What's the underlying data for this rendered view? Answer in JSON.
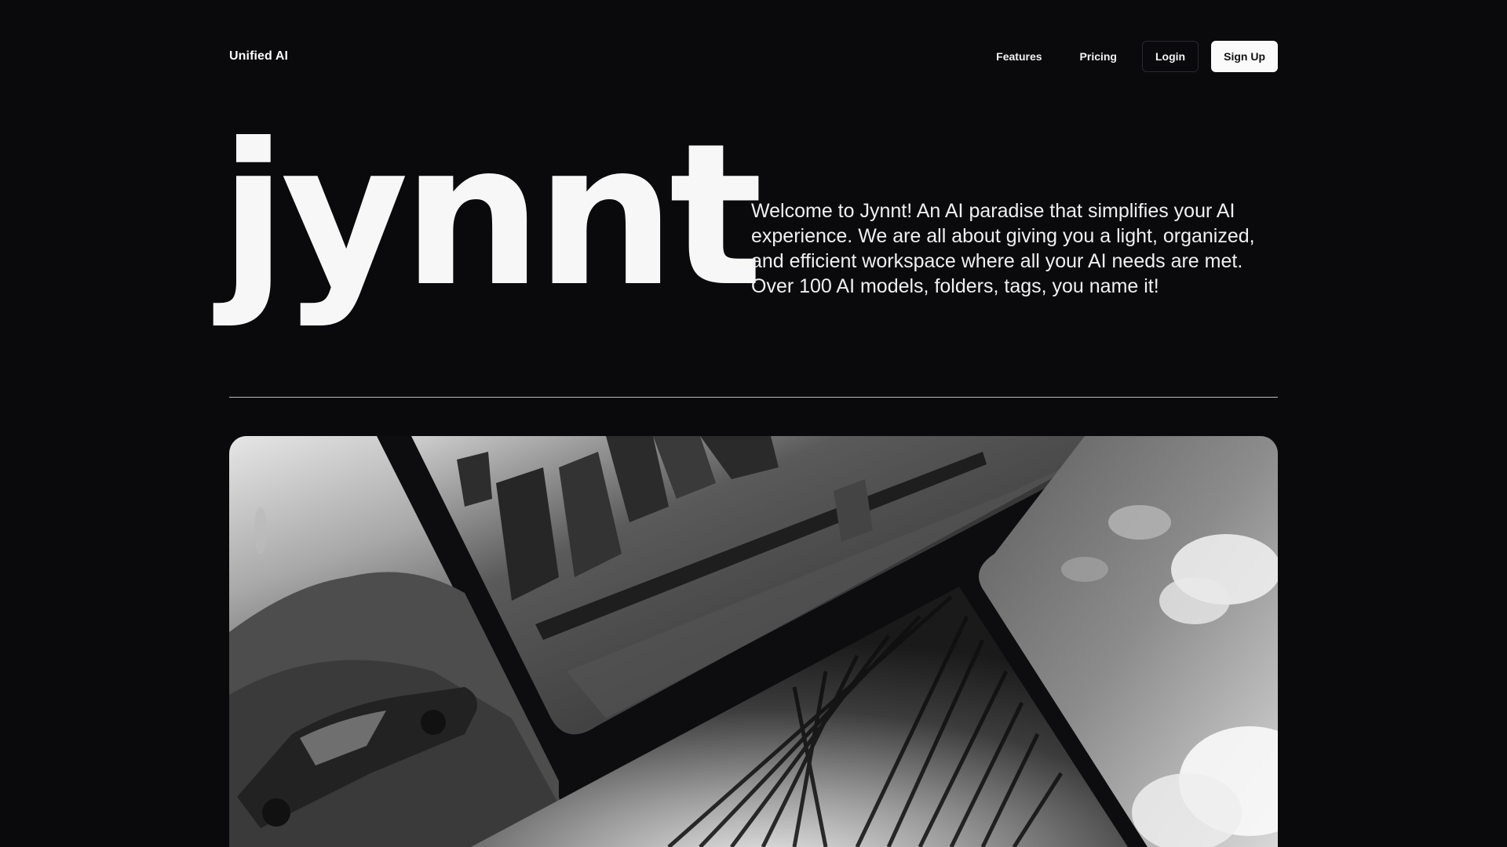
{
  "nav": {
    "brand": "Unified AI",
    "links": [
      {
        "label": "Features"
      },
      {
        "label": "Pricing"
      }
    ],
    "login_label": "Login",
    "signup_label": "Sign Up"
  },
  "hero": {
    "logo_word": "jynnt",
    "intro": "Welcome to Jynnt! An AI paradise that simplifies your AI experience. We are all about giving you a light, organized, and efficient workspace where all your AI needs are met. Over 100 AI models, folders, tags, you name it!"
  },
  "gallery": {
    "tiles": [
      {
        "name": "car-on-mountain-image"
      },
      {
        "name": "city-bridge-image"
      },
      {
        "name": "forest-canopy-image"
      },
      {
        "name": "clouds-sky-image"
      }
    ]
  }
}
